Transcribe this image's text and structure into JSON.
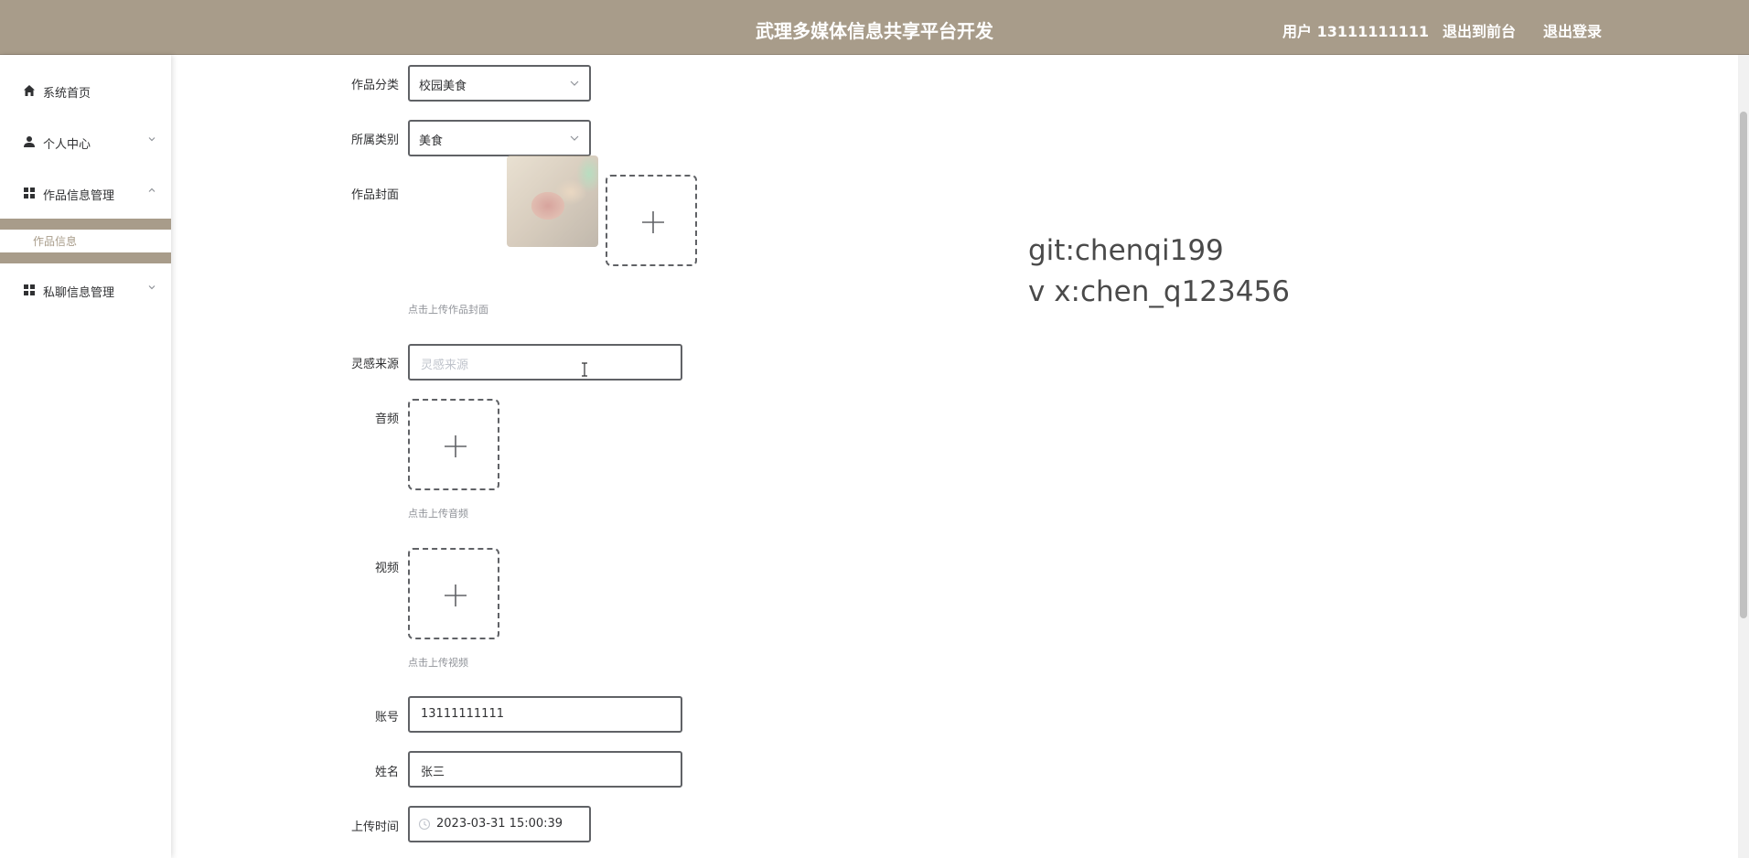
{
  "header": {
    "title": "武理多媒体信息共享平台开发",
    "user": "用户 13111111111",
    "back_to_front": "退出到前台",
    "logout": "退出登录"
  },
  "sidebar": {
    "items": [
      {
        "label": "系统首页",
        "icon": "home-icon"
      },
      {
        "label": "个人中心",
        "icon": "user-icon"
      },
      {
        "label": "作品信息管理",
        "icon": "grid-icon"
      },
      {
        "label": "私聊信息管理",
        "icon": "grid-icon"
      }
    ],
    "subitem": "作品信息"
  },
  "form": {
    "category": {
      "label": "作品分类",
      "value": "校园美食"
    },
    "type": {
      "label": "所属类别",
      "value": "美食"
    },
    "cover": {
      "label": "作品封面",
      "hint": "点击上传作品封面"
    },
    "inspiration": {
      "label": "灵感来源",
      "placeholder": "灵感来源"
    },
    "audio": {
      "label": "音频",
      "hint": "点击上传音频"
    },
    "video": {
      "label": "视频",
      "hint": "点击上传视频"
    },
    "account": {
      "label": "账号",
      "value": "13111111111"
    },
    "name": {
      "label": "姓名",
      "value": "张三"
    },
    "upload_time": {
      "label": "上传时间",
      "value": "2023-03-31 15:00:39"
    }
  },
  "watermark": {
    "line1": "git:chenqi199",
    "line2": "v x:chen_q123456"
  },
  "colors": {
    "header_bg": "#a89c8a",
    "accent": "#a89c8a"
  }
}
